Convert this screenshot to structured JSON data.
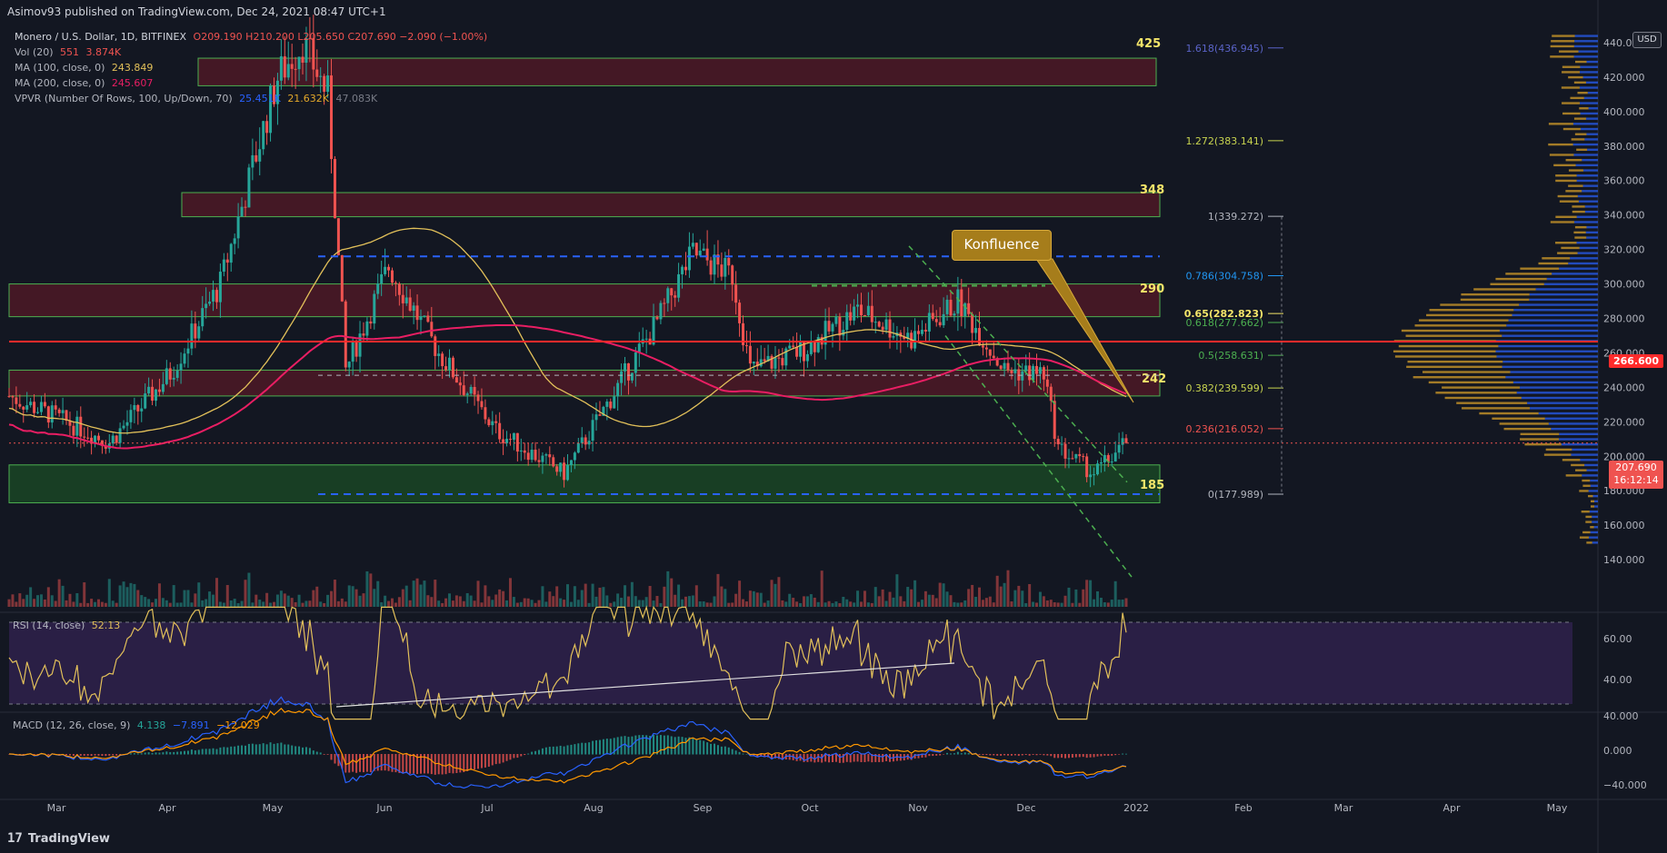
{
  "header": {
    "published": "Asimov93 published on TradingView.com, Dec 24, 2021 08:47 UTC+1"
  },
  "legend": {
    "symbol": "Monero / U.S. Dollar, 1D, BITFINEX",
    "ohlc": "O209.190 H210.200 L205.650 C207.690 −2.090 (−1.00%)",
    "vol_label": "Vol (20)",
    "vol_v1": "551",
    "vol_v2": "3.874K",
    "ma100_label": "MA (100, close, 0)",
    "ma100_val": "243.849",
    "ma200_label": "MA (200, close, 0)",
    "ma200_val": "245.607",
    "vpvr_label": "VPVR (Number Of Rows, 100, Up/Down, 70)",
    "vpvr_v1": "25.451K",
    "vpvr_v2": "21.632K",
    "vpvr_v3": "47.083K"
  },
  "currency_button": "USD",
  "annotation": "Konfluence",
  "zone_labels": [
    "425",
    "348",
    "290",
    "242",
    "185"
  ],
  "fib_labels": [
    "1.618(436.945)",
    "1.272(383.141)",
    "1(339.272)",
    "0.786(304.758)",
    "0.65(282.823)",
    "0.618(277.662)",
    "0.5(258.631)",
    "0.382(239.599)",
    "0.236(216.052)",
    "0(177.989)"
  ],
  "price_axis": [
    "440.000",
    "420.000",
    "400.000",
    "380.000",
    "360.000",
    "340.000",
    "320.000",
    "300.000",
    "280.000",
    "260.000",
    "240.000",
    "220.000",
    "200.000",
    "180.000",
    "160.000",
    "140.000"
  ],
  "price_tags": {
    "line": "266.600",
    "last": "207.690",
    "countdown": "16:12:14"
  },
  "rsi": {
    "label": "RSI (14, close)",
    "value": "52.13",
    "axis": [
      "60.00",
      "40.00"
    ]
  },
  "macd": {
    "label": "MACD (12, 26, close, 9)",
    "v1": "4.138",
    "v2": "−7.891",
    "v3": "−12.029",
    "axis": [
      "40.000",
      "0.000",
      "−40.000"
    ]
  },
  "time_axis": [
    "Mar",
    "Apr",
    "May",
    "Jun",
    "Jul",
    "Aug",
    "Sep",
    "Oct",
    "Nov",
    "Dec",
    "2022",
    "Feb",
    "Mar",
    "Apr",
    "May"
  ],
  "brand": "TradingView",
  "colors": {
    "bg": "#131722",
    "up": "#26a69a",
    "down": "#ef5350",
    "ma100": "#e3c15a",
    "ma200": "#e91e63",
    "zone_red": "#5a1a26",
    "zone_green": "#1a5a26",
    "level_line": "#ff2b2b",
    "dash_blue": "#2962ff"
  },
  "chart_data": {
    "type": "candlestick",
    "symbol": "XMR/USD",
    "ylim": [
      130,
      450
    ],
    "last_close": 207.69,
    "resistance_line": 266.6,
    "zones": [
      {
        "low": 415,
        "high": 431
      },
      {
        "low": 339,
        "high": 353
      },
      {
        "low": 281,
        "high": 300
      },
      {
        "low": 235,
        "high": 250
      },
      {
        "low": 173,
        "high": 195
      }
    ],
    "fib_levels": [
      436.945,
      383.141,
      339.272,
      304.758,
      282.823,
      277.662,
      258.631,
      239.599,
      216.052,
      177.989
    ],
    "close_anchors": [
      [
        "Feb 15",
        235
      ],
      [
        "Mar 1",
        222
      ],
      [
        "Mar 15",
        208
      ],
      [
        "Apr 1",
        248
      ],
      [
        "Apr 15",
        300
      ],
      [
        "May 1",
        420
      ],
      [
        "May 8",
        440
      ],
      [
        "May 15",
        410
      ],
      [
        "May 20",
        250
      ],
      [
        "Jun 1",
        310
      ],
      [
        "Jun 15",
        260
      ],
      [
        "Jul 1",
        215
      ],
      [
        "Jul 20",
        190
      ],
      [
        "Aug 1",
        230
      ],
      [
        "Aug 15",
        278
      ],
      [
        "Aug 25",
        318
      ],
      [
        "Sep 5",
        305
      ],
      [
        "Sep 10",
        250
      ],
      [
        "Sep 25",
        262
      ],
      [
        "Oct 10",
        285
      ],
      [
        "Oct 25",
        268
      ],
      [
        "Nov 7",
        290
      ],
      [
        "Nov 20",
        250
      ],
      [
        "Dec 1",
        248
      ],
      [
        "Dec 5",
        205
      ],
      [
        "Dec 15",
        190
      ],
      [
        "Dec 24",
        207.69
      ]
    ]
  }
}
